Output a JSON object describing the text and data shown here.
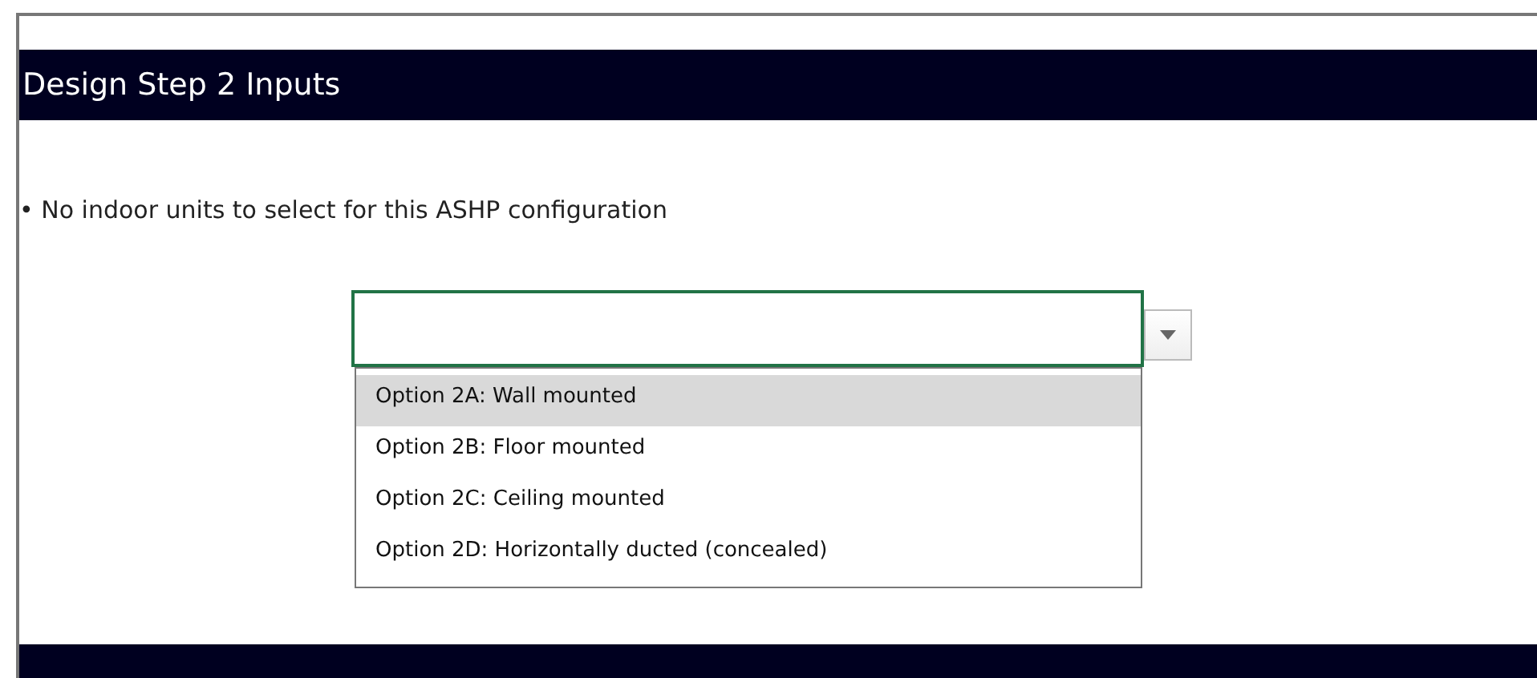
{
  "header": {
    "title": "Design Step 2 Inputs"
  },
  "message": "• No indoor units to select for this ASHP configuration",
  "dropdown": {
    "options": [
      {
        "label": "Option 2A: Wall mounted",
        "selected": true
      },
      {
        "label": "Option 2B: Floor mounted",
        "selected": false
      },
      {
        "label": "Option 2C: Ceiling mounted",
        "selected": false
      },
      {
        "label": "Option 2D: Horizontally ducted (concealed)",
        "selected": false
      }
    ]
  }
}
